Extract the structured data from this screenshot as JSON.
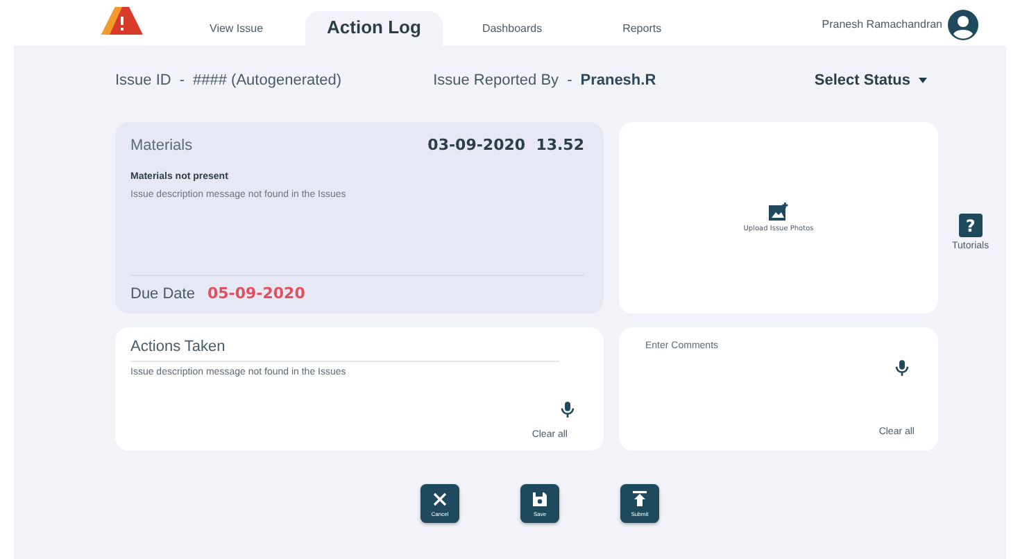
{
  "nav": {
    "tabs": [
      {
        "label": "View Issue",
        "selected": false
      },
      {
        "label": "Action Log",
        "selected": true
      },
      {
        "label": "Dashboards",
        "selected": false
      },
      {
        "label": "Reports",
        "selected": false
      }
    ],
    "user": "Pranesh Ramachandran"
  },
  "issue_header": {
    "id_label": "Issue ID",
    "id_sep": "-",
    "id_value": "#### (Autogenerated)",
    "reporter_label": "Issue Reported By",
    "reporter_sep": "-",
    "reporter_value": "Pranesh.R",
    "status_select": "Select Status"
  },
  "materials": {
    "title": "Materials",
    "date": "03-09-2020  13.52",
    "subtitle": "Materials not present",
    "description": "Issue description message not found in the Issues",
    "due_label": "Due Date",
    "due_value": "05-09-2020"
  },
  "upload": {
    "label": "Upload Issue Photos"
  },
  "actions_taken": {
    "title": "Actions Taken",
    "value": "Issue description message not found in the Issues",
    "clear": "Clear all"
  },
  "comments": {
    "placeholder": "Enter Comments",
    "clear": "Clear all"
  },
  "buttons": [
    {
      "kind": "cancel",
      "label": "Cancel"
    },
    {
      "kind": "save",
      "label": "Save"
    },
    {
      "kind": "submit",
      "label": "Submit"
    }
  ],
  "tutorials": {
    "label": "Tutorials",
    "icon": "?"
  }
}
